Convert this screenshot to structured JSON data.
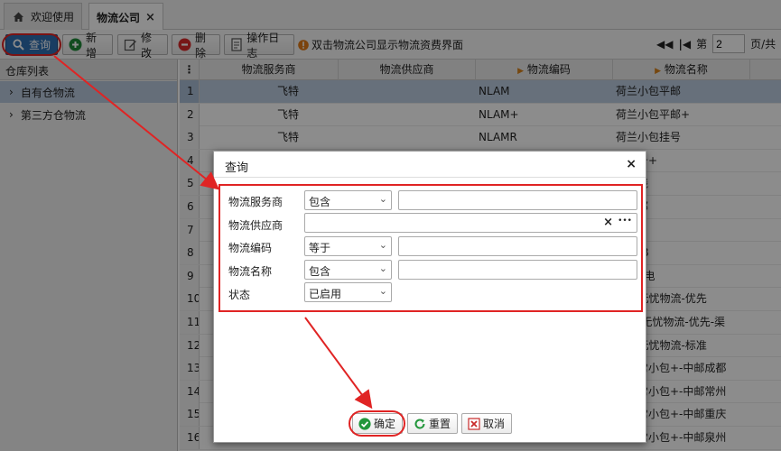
{
  "tabs": [
    {
      "label": "欢迎使用",
      "icon": "home-icon",
      "active": false
    },
    {
      "label": "物流公司",
      "active": true,
      "close": "×"
    }
  ],
  "toolbar": {
    "query": "查询",
    "add": "新增",
    "edit": "修改",
    "delete": "删除",
    "log": "操作日志",
    "hint": "双击物流公司显示物流资费界面",
    "page_prefix": "第",
    "page_value": "2",
    "page_suffix": "页/共"
  },
  "left_panel": {
    "title": "仓库列表",
    "items": [
      {
        "label": "自有仓物流",
        "selected": true
      },
      {
        "label": "第三方仓物流",
        "selected": false
      }
    ]
  },
  "grid": {
    "columns": [
      "物流服务商",
      "物流供应商",
      "物流编码",
      "物流名称"
    ],
    "rows": [
      {
        "n": "1",
        "provider": "飞特",
        "supplier": "",
        "code": "NLAM",
        "name": "荷兰小包平邮",
        "selected": true
      },
      {
        "n": "2",
        "provider": "飞特",
        "supplier": "",
        "code": "NLAM+",
        "name": "荷兰小包平邮+"
      },
      {
        "n": "3",
        "provider": "飞特",
        "supplier": "",
        "code": "NLAMR",
        "name": "荷兰小包挂号"
      },
      {
        "n": "4",
        "provider": "",
        "supplier": "",
        "code": "",
        "name": "包挂号+"
      },
      {
        "n": "5",
        "provider": "",
        "supplier": "",
        "code": "",
        "name": "兰专线"
      },
      {
        "n": "6",
        "provider": "",
        "supplier": "",
        "code": "",
        "name": "包平邮"
      },
      {
        "n": "7",
        "provider": "",
        "supplier": "",
        "code": "",
        "name": "DHL"
      },
      {
        "n": "8",
        "provider": "",
        "supplier": "",
        "code": "",
        "name": "下EUB"
      },
      {
        "n": "9",
        "provider": "",
        "supplier": "",
        "code": "",
        "name": "NT-带电"
      },
      {
        "n": "10",
        "provider": "",
        "supplier": "",
        "code": "",
        "name": "ress无忧物流-优先"
      },
      {
        "n": "11",
        "provider": "",
        "supplier": "",
        "code": "",
        "name": "ress 无忧物流-优先-渠"
      },
      {
        "n": "12",
        "provider": "",
        "supplier": "",
        "code": "",
        "name": "ress无忧物流-标准"
      },
      {
        "n": "13",
        "provider": "",
        "supplier": "",
        "code": "",
        "name": "政平常小包+-中邮成都"
      },
      {
        "n": "14",
        "provider": "",
        "supplier": "",
        "code": "",
        "name": "政平常小包+-中邮常州"
      },
      {
        "n": "15",
        "provider": "",
        "supplier": "",
        "code": "",
        "name": "政平常小包+-中邮重庆"
      },
      {
        "n": "16",
        "provider": "",
        "supplier": "",
        "code": "",
        "name": "政平常小包+-中邮泉州"
      }
    ]
  },
  "modal": {
    "title": "查询",
    "close": "×",
    "fields": [
      {
        "label": "物流服务商",
        "operator": "包含",
        "value": ""
      },
      {
        "label": "物流供应商",
        "value": "",
        "clear": "×",
        "more": "•••"
      },
      {
        "label": "物流编码",
        "operator": "等于",
        "value": ""
      },
      {
        "label": "物流名称",
        "operator": "包含",
        "value": ""
      },
      {
        "label": "状态",
        "operator": "已启用"
      }
    ],
    "buttons": {
      "ok": "确定",
      "reset": "重置",
      "cancel": "取消"
    }
  },
  "colors": {
    "accent": "#2f6fb3",
    "annotation": "#e02424",
    "selected_row": "#bccde1"
  }
}
